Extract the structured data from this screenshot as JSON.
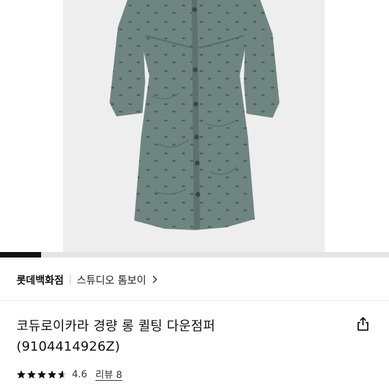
{
  "product": {
    "image_alt": "",
    "image_count_progress": 0.105,
    "store": "롯데백화점",
    "brand": "스튜디오 톰보이",
    "title_line1": "코듀로이카라 경량 롱 퀼팅 다운점퍼",
    "title_line2": "(9104414926Z)",
    "rating": 4.6,
    "rating_text": "4.6",
    "review_text": "리뷰 8"
  },
  "icons": {
    "brand_chevron": "chevron-right-icon",
    "share": "share-icon",
    "star": "star-icon"
  },
  "colors": {
    "coat": "#6f8581",
    "coat_dark": "#566b67",
    "star": "#111111",
    "progress": "#111111"
  }
}
